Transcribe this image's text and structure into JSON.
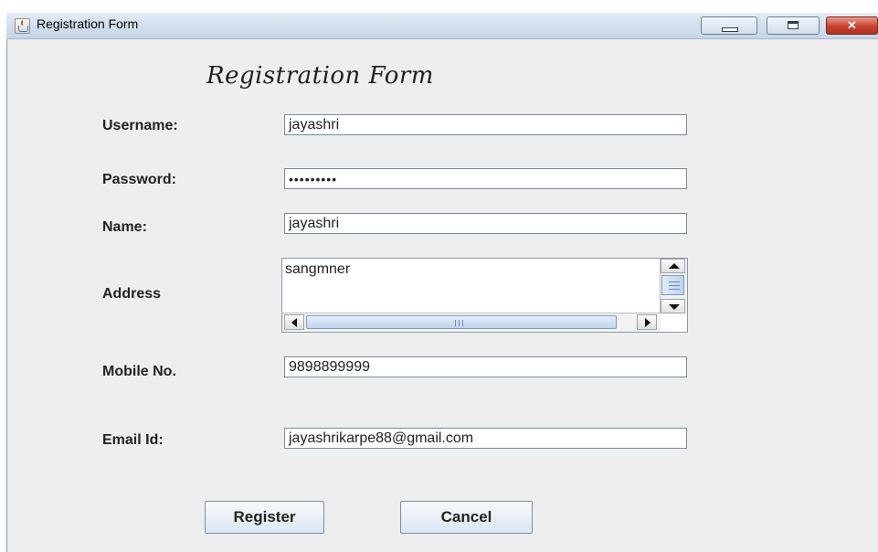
{
  "window": {
    "title": "Registration Form",
    "close_glyph": "✕"
  },
  "form": {
    "heading": "Registration Form",
    "username": {
      "label": "Username:",
      "value": "jayashri"
    },
    "password": {
      "label": "Password:",
      "value": "•••••••••"
    },
    "name": {
      "label": "Name:",
      "value": "jayashri"
    },
    "address": {
      "label": "Address",
      "value": "sangmner"
    },
    "mobile": {
      "label": "Mobile No.",
      "value": "9898899999"
    },
    "email": {
      "label": "Email Id:",
      "value": "jayashrikarpe88@gmail.com"
    },
    "register_label": "Register",
    "cancel_label": "Cancel"
  },
  "icons": {
    "app": "java-cup-icon",
    "minimize": "minimize-icon",
    "maximize": "maximize-icon",
    "close": "close-icon"
  },
  "colors": {
    "window_bg": "#eeeeee",
    "titlebar": "#d3dfee",
    "close_button": "#c7412f",
    "scroll_thumb": "#bcd3ee"
  }
}
